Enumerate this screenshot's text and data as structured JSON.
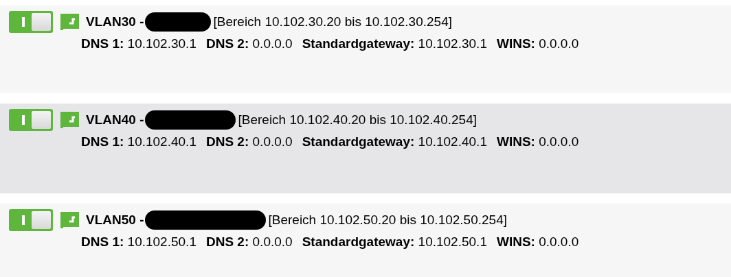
{
  "networks": [
    {
      "name": "VLAN30 -",
      "range": "[Bereich 10.102.30.20 bis 10.102.30.254]",
      "enabled": true,
      "highlighted": false,
      "details": [
        {
          "label": "DNS 1:",
          "value": "10.102.30.1"
        },
        {
          "label": "DNS 2:",
          "value": "0.0.0.0"
        },
        {
          "label": "Standardgateway:",
          "value": "10.102.30.1"
        },
        {
          "label": "WINS:",
          "value": "0.0.0.0"
        }
      ]
    },
    {
      "name": "VLAN40 -",
      "range": "[Bereich 10.102.40.20 bis 10.102.40.254]",
      "enabled": true,
      "highlighted": true,
      "details": [
        {
          "label": "DNS 1:",
          "value": "10.102.40.1"
        },
        {
          "label": "DNS 2:",
          "value": "0.0.0.0"
        },
        {
          "label": "Standardgateway:",
          "value": "10.102.40.1"
        },
        {
          "label": "WINS:",
          "value": "0.0.0.0"
        }
      ]
    },
    {
      "name": "VLAN50 -",
      "range": "[Bereich 10.102.50.20 bis 10.102.50.254]",
      "enabled": true,
      "highlighted": false,
      "details": [
        {
          "label": "DNS 1:",
          "value": "10.102.50.1"
        },
        {
          "label": "DNS 2:",
          "value": "0.0.0.0"
        },
        {
          "label": "Standardgateway:",
          "value": "10.102.50.1"
        },
        {
          "label": "WINS:",
          "value": "0.0.0.0"
        }
      ]
    }
  ]
}
